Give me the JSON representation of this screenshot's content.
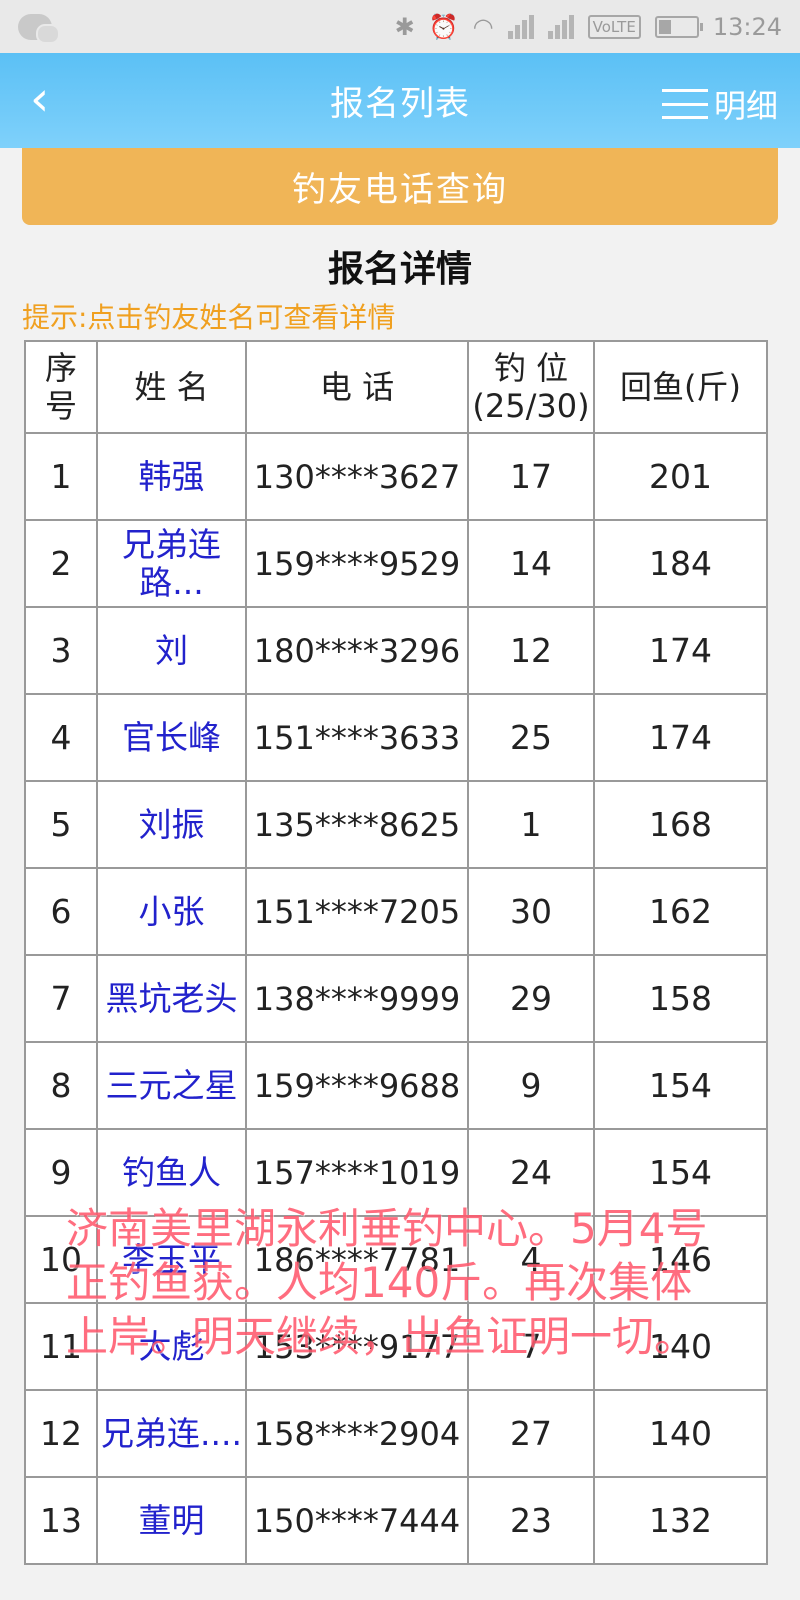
{
  "statusbar": {
    "time": "13:24",
    "network": "VoLTE"
  },
  "header": {
    "back_glyph": "‹",
    "title": "报名列表",
    "menu_label": "明细"
  },
  "search_button": "钓友电话查询",
  "section_title": "报名详情",
  "hint": "提示:点击钓友姓名可查看详情",
  "table": {
    "headers": {
      "index": "序号",
      "name": "姓 名",
      "phone": "电 话",
      "seat": "钓 位",
      "seat_sub": "(25/30)",
      "catch": "回鱼(斤)"
    },
    "rows": [
      {
        "index": "1",
        "name": "韩强",
        "phone": "130****3627",
        "seat": "17",
        "catch": "201"
      },
      {
        "index": "2",
        "name": "兄弟连路...",
        "phone": "159****9529",
        "seat": "14",
        "catch": "184"
      },
      {
        "index": "3",
        "name": "刘",
        "phone": "180****3296",
        "seat": "12",
        "catch": "174"
      },
      {
        "index": "4",
        "name": "官长峰",
        "phone": "151****3633",
        "seat": "25",
        "catch": "174"
      },
      {
        "index": "5",
        "name": "刘振",
        "phone": "135****8625",
        "seat": "1",
        "catch": "168"
      },
      {
        "index": "6",
        "name": "小张",
        "phone": "151****7205",
        "seat": "30",
        "catch": "162"
      },
      {
        "index": "7",
        "name": "黑坑老头",
        "phone": "138****9999",
        "seat": "29",
        "catch": "158"
      },
      {
        "index": "8",
        "name": "三元之星",
        "phone": "159****9688",
        "seat": "9",
        "catch": "154"
      },
      {
        "index": "9",
        "name": "钓鱼人",
        "phone": "157****1019",
        "seat": "24",
        "catch": "154"
      },
      {
        "index": "10",
        "name": "李玉平",
        "phone": "186****7781",
        "seat": "4",
        "catch": "146"
      },
      {
        "index": "11",
        "name": "大彪",
        "phone": "153****9177",
        "seat": "7",
        "catch": "140"
      },
      {
        "index": "12",
        "name": "兄弟连....",
        "phone": "158****2904",
        "seat": "27",
        "catch": "140"
      },
      {
        "index": "13",
        "name": "董明",
        "phone": "150****7444",
        "seat": "23",
        "catch": "132"
      }
    ]
  },
  "overlay_text": "济南美里湖永利垂钓中心。5月4号正钓鱼获。人均140斤。再次集体上岸。明天继续，出鱼证明一切。",
  "colors": {
    "header": "#5bc0f5",
    "search_button": "#f0b557",
    "hint": "#f0a020",
    "name_link": "#2222cc",
    "overlay": "#ff5a6e"
  }
}
